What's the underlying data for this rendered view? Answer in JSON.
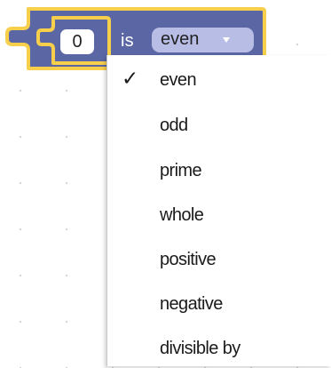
{
  "block": {
    "number_value": "0",
    "is_label": "is",
    "selected_option": "even",
    "colors": {
      "block_fill": "#5b67a5",
      "block_highlight": "#f7cf4b",
      "field_bg": "#ffffff",
      "dropdown_bg": "#b8bde6"
    }
  },
  "menu": {
    "check_symbol": "✓",
    "options": [
      {
        "label": "even",
        "checked": true
      },
      {
        "label": "odd",
        "checked": false
      },
      {
        "label": "prime",
        "checked": false
      },
      {
        "label": "whole",
        "checked": false
      },
      {
        "label": "positive",
        "checked": false
      },
      {
        "label": "negative",
        "checked": false
      },
      {
        "label": "divisible by",
        "checked": false
      }
    ]
  },
  "icons": {
    "dropdown_arrow": "triangle-down-icon",
    "check": "checkmark-icon"
  }
}
